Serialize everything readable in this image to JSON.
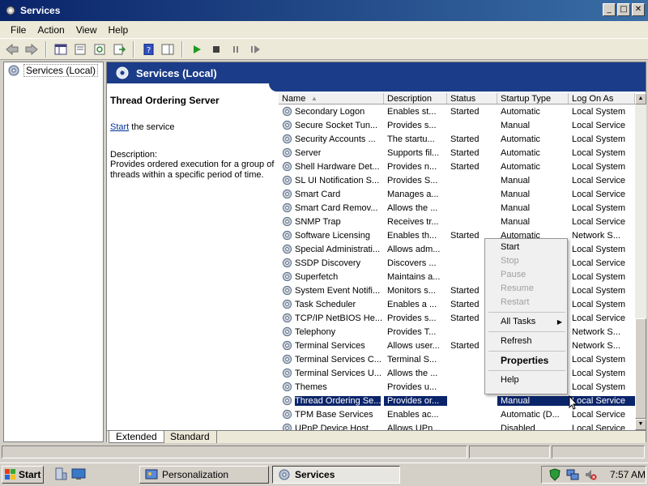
{
  "window": {
    "title": "Services",
    "min": "_",
    "max": "□",
    "close": "✕"
  },
  "menu": [
    "File",
    "Action",
    "View",
    "Help"
  ],
  "tree": {
    "root": "Services (Local)"
  },
  "banner": {
    "title": "Services (Local)"
  },
  "detail": {
    "name": "Thread Ordering Server",
    "start_link": "Start",
    "start_rest": " the service",
    "desc_label": "Description:",
    "desc_text": "Provides ordered execution for a group of threads within a specific period of time."
  },
  "columns": [
    "Name",
    "Description",
    "Status",
    "Startup Type",
    "Log On As"
  ],
  "rows": [
    [
      "Secondary Logon",
      "Enables st...",
      "Started",
      "Automatic",
      "Local System"
    ],
    [
      "Secure Socket Tun...",
      "Provides s...",
      "",
      "Manual",
      "Local Service"
    ],
    [
      "Security Accounts ...",
      "The startu...",
      "Started",
      "Automatic",
      "Local System"
    ],
    [
      "Server",
      "Supports fil...",
      "Started",
      "Automatic",
      "Local System"
    ],
    [
      "Shell Hardware Det...",
      "Provides n...",
      "Started",
      "Automatic",
      "Local System"
    ],
    [
      "SL UI Notification S...",
      "Provides S...",
      "",
      "Manual",
      "Local Service"
    ],
    [
      "Smart Card",
      "Manages a...",
      "",
      "Manual",
      "Local Service"
    ],
    [
      "Smart Card Remov...",
      "Allows the ...",
      "",
      "Manual",
      "Local System"
    ],
    [
      "SNMP Trap",
      "Receives tr...",
      "",
      "Manual",
      "Local Service"
    ],
    [
      "Software Licensing",
      "Enables th...",
      "Started",
      "Automatic",
      "Network S..."
    ],
    [
      "Special Administrati...",
      "Allows adm...",
      "",
      "",
      "Local System"
    ],
    [
      "SSDP Discovery",
      "Discovers ...",
      "",
      "",
      "Local Service"
    ],
    [
      "Superfetch",
      "Maintains a...",
      "",
      "",
      "Local System"
    ],
    [
      "System Event Notifi...",
      "Monitors s...",
      "Started",
      "",
      "Local System"
    ],
    [
      "Task Scheduler",
      "Enables a ...",
      "Started",
      "",
      "Local System"
    ],
    [
      "TCP/IP NetBIOS He...",
      "Provides s...",
      "Started",
      "",
      "Local Service"
    ],
    [
      "Telephony",
      "Provides T...",
      "",
      "",
      "Network S..."
    ],
    [
      "Terminal Services",
      "Allows user...",
      "Started",
      "",
      "Network S..."
    ],
    [
      "Terminal Services C...",
      "Terminal S...",
      "",
      "",
      "Local System"
    ],
    [
      "Terminal Services U...",
      "Allows the ...",
      "",
      "",
      "Local System"
    ],
    [
      "Themes",
      "Provides u...",
      "",
      "",
      "Local System"
    ],
    [
      "Thread Ordering Se...",
      "Provides or...",
      "",
      "Manual",
      "Local Service"
    ],
    [
      "TPM Base Services",
      "Enables ac...",
      "",
      "Automatic (D...",
      "Local Service"
    ],
    [
      "UPnP Device Host",
      "Allows UPn...",
      "",
      "Disabled",
      "Local Service"
    ]
  ],
  "selected_row": 21,
  "tabs": {
    "extended": "Extended",
    "standard": "Standard"
  },
  "context_menu": {
    "start": "Start",
    "stop": "Stop",
    "pause": "Pause",
    "resume": "Resume",
    "restart": "Restart",
    "all_tasks": "All Tasks",
    "refresh": "Refresh",
    "properties": "Properties",
    "help": "Help"
  },
  "taskbar": {
    "start": "Start",
    "tasks": [
      "Personalization",
      "Services"
    ],
    "clock": "7:57 AM"
  }
}
